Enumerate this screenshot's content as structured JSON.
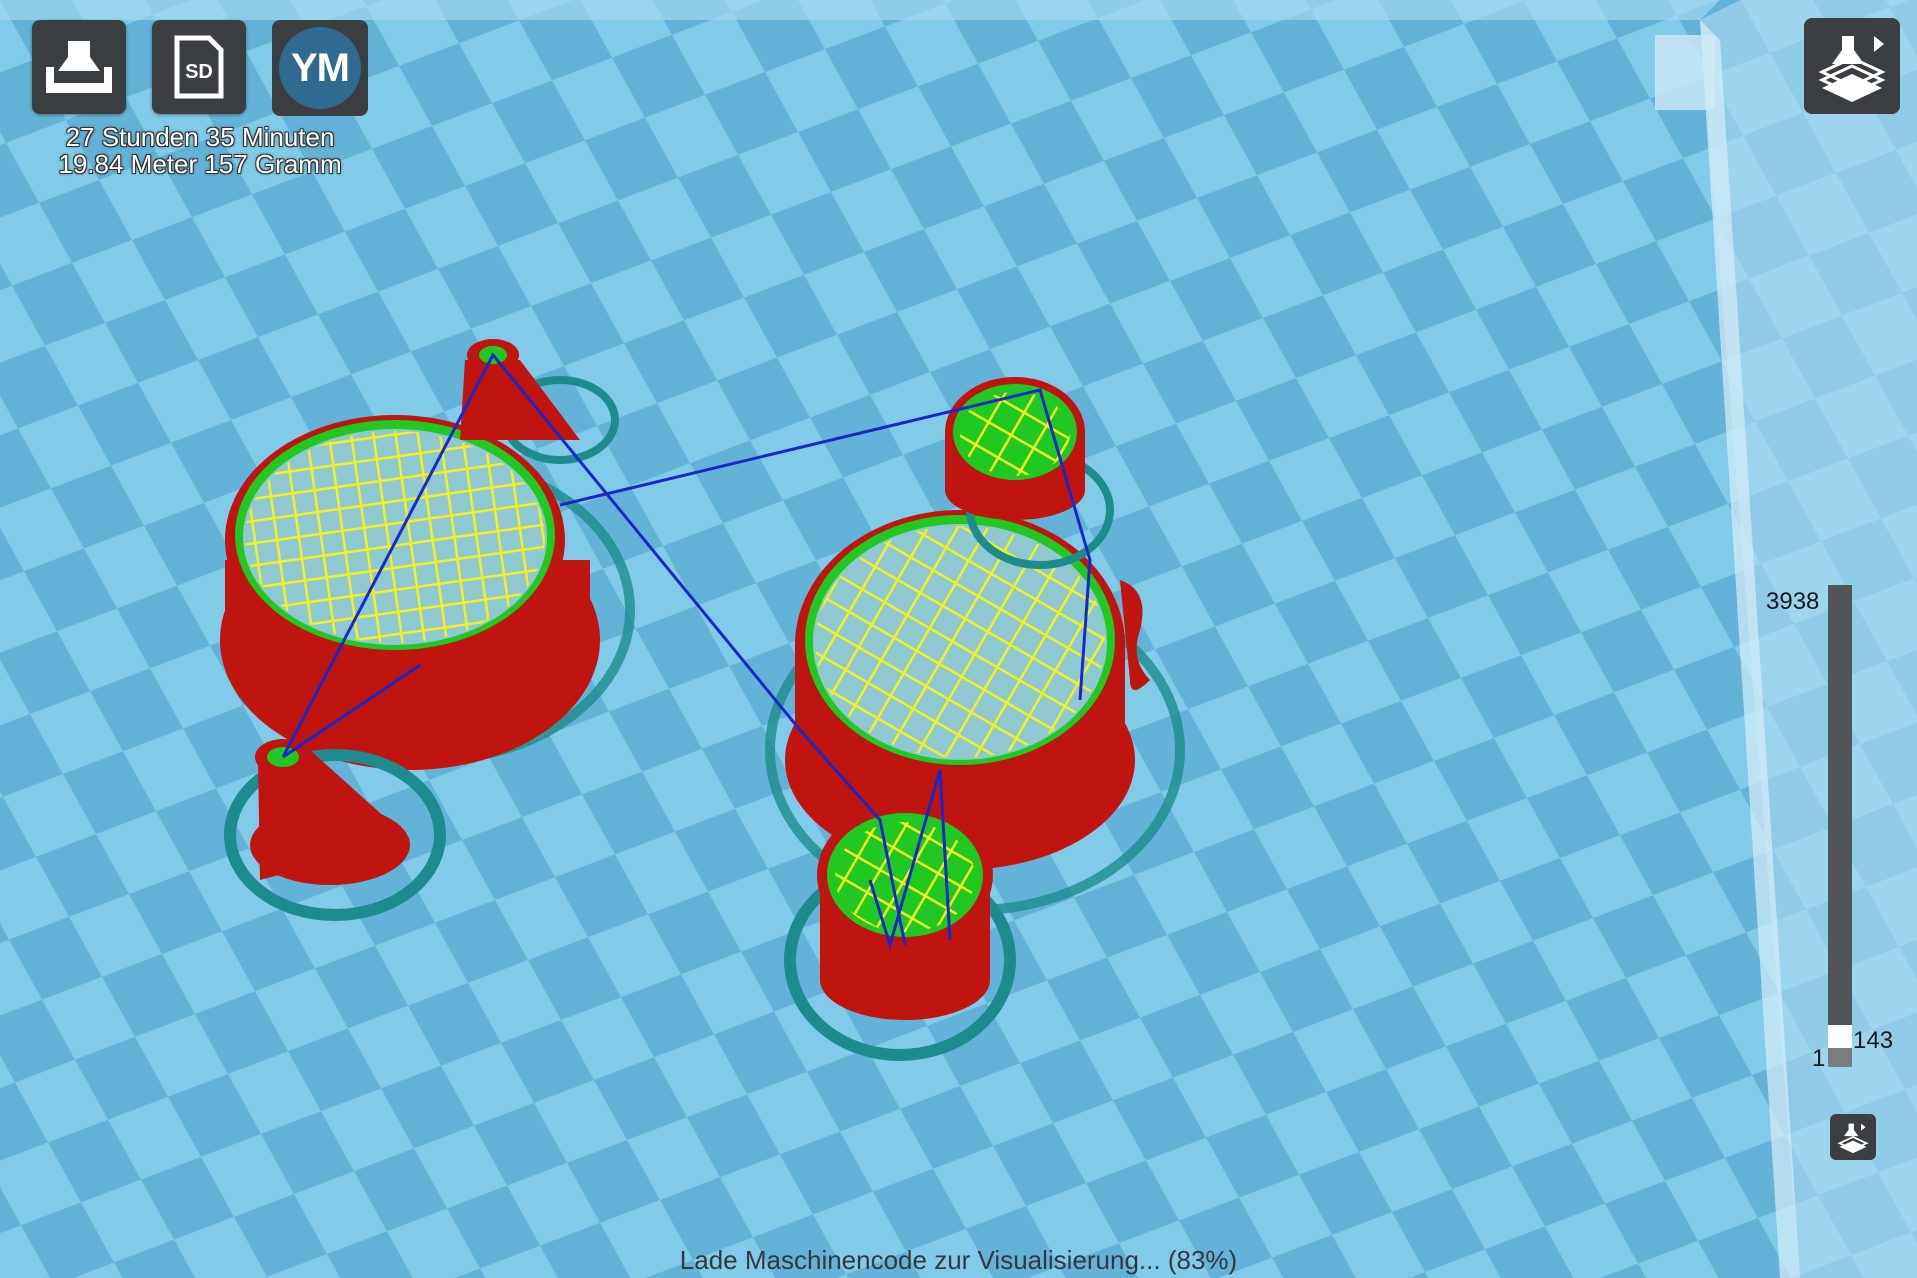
{
  "toolbar": {
    "print_button_icon": "printer-tray-icon",
    "sd_button_label": "SD",
    "account_initials": "YM"
  },
  "print_info": {
    "time": "27 Stunden 35 Minuten",
    "material": "19.84 Meter 157 Gramm"
  },
  "layer_slider": {
    "max_value": "3938",
    "current_value": "143",
    "min_value": "1",
    "current_fraction": 0.036
  },
  "view_mode_icon": "layer-view-icon",
  "status": {
    "message": "Lade Maschinencode zur Visualisierung... (83%)",
    "progress_percent": 83
  },
  "colors": {
    "build_plate_light": "#7ec9e6",
    "build_plate_dark": "#5fb0d4",
    "wall_outer": "#c0140e",
    "wall_inner": "#22c822",
    "infill": "#f0f020",
    "travel": "#1a28c8",
    "skirt": "#1e8c8c"
  }
}
